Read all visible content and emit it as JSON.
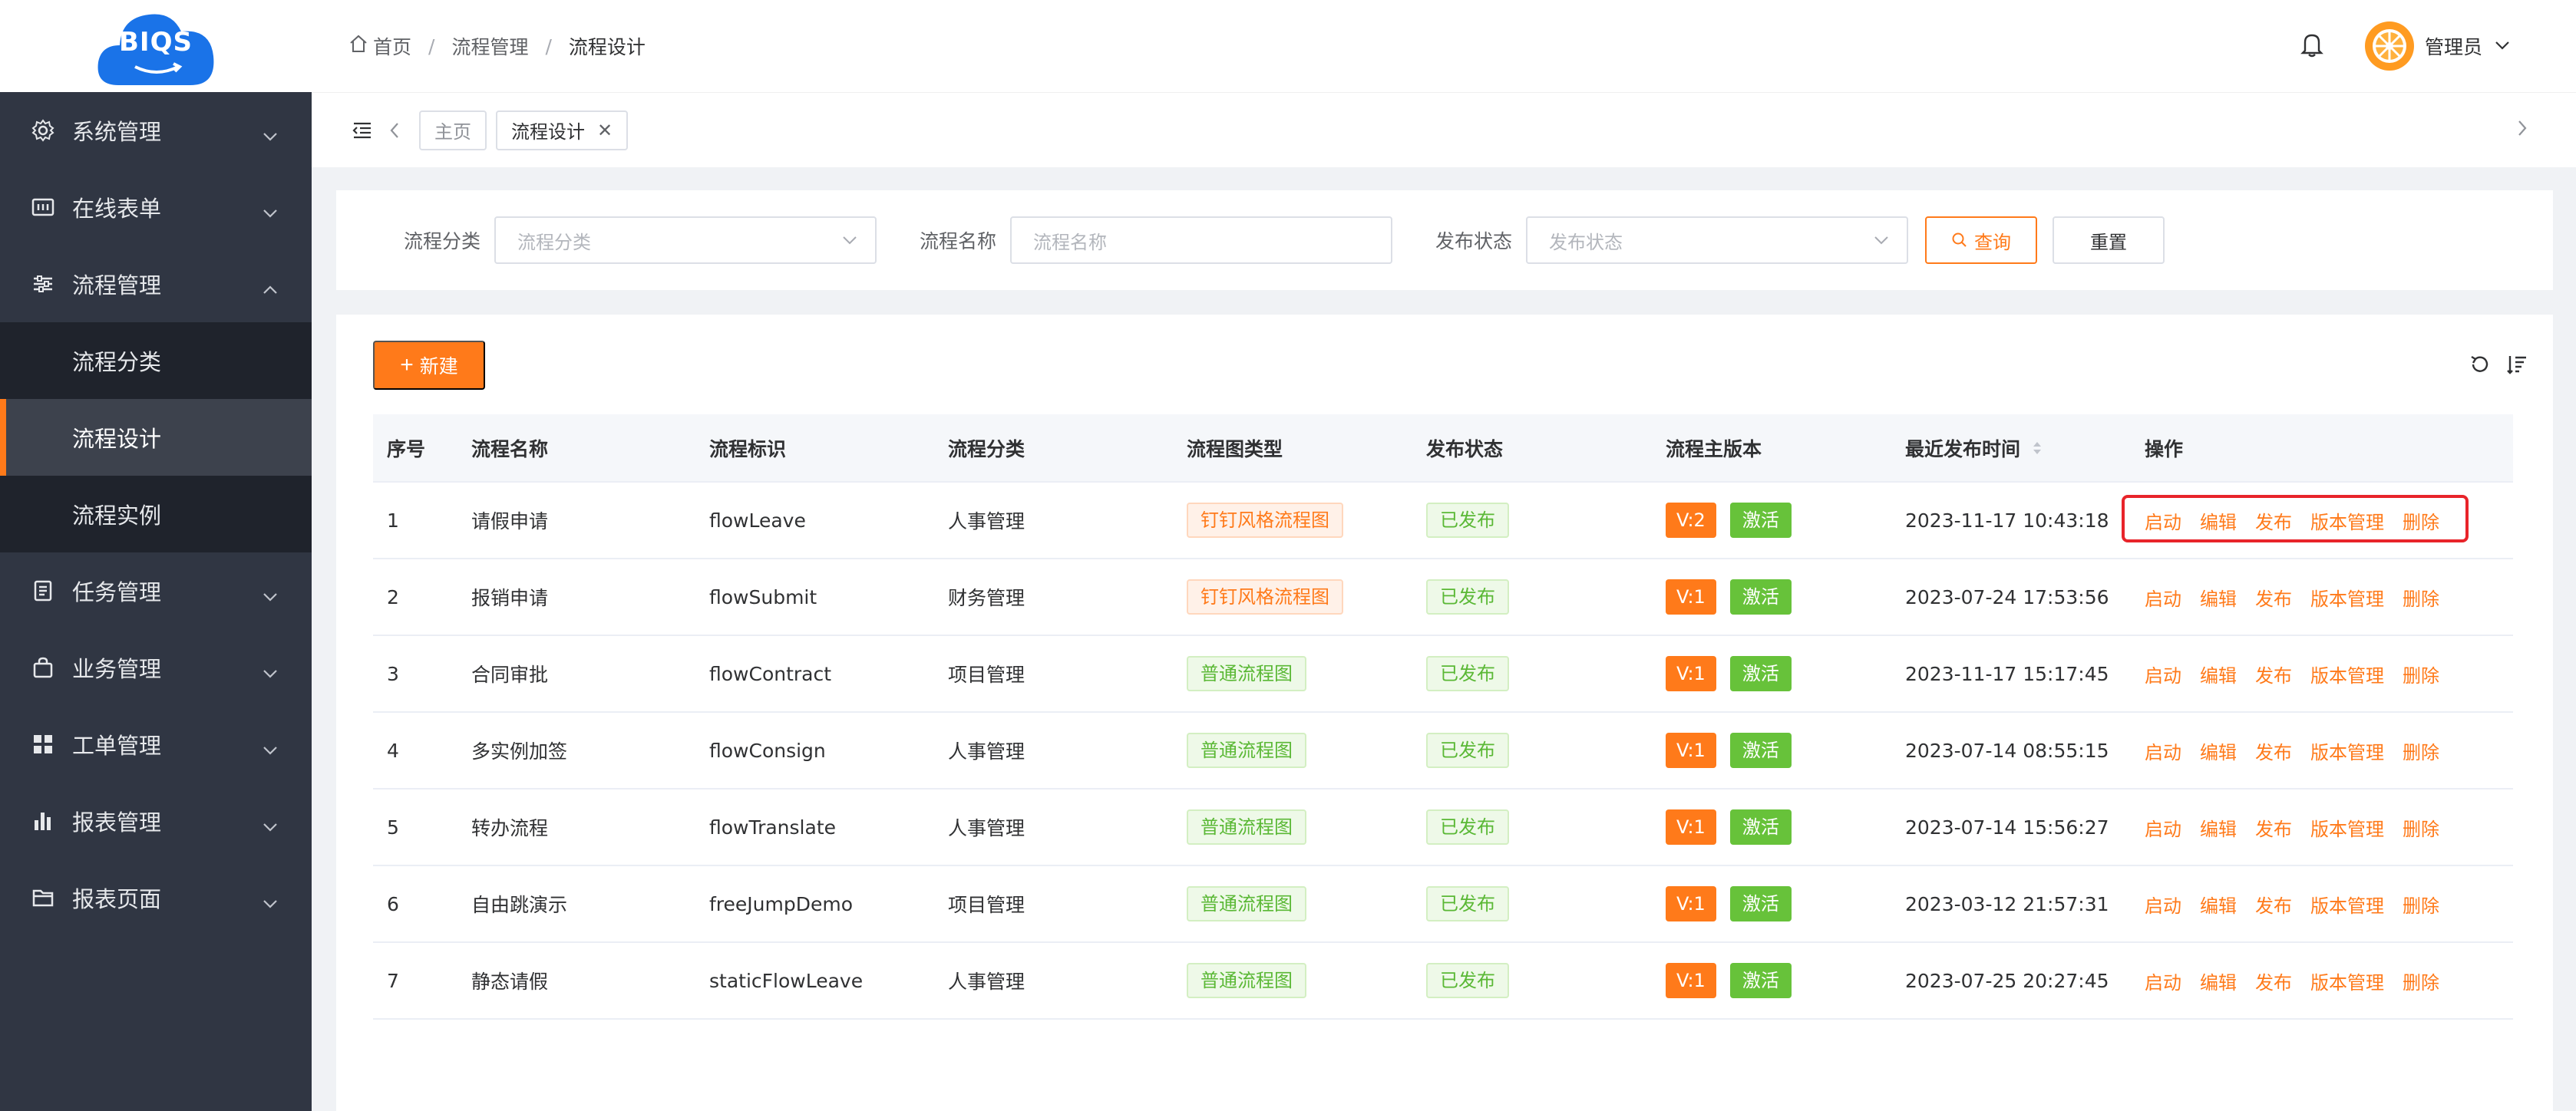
{
  "logo": {
    "text": "BIQS"
  },
  "sidebar": {
    "items": [
      {
        "label": "系统管理",
        "icon": "gear-icon"
      },
      {
        "label": "在线表单",
        "icon": "form-icon"
      },
      {
        "label": "流程管理",
        "icon": "sliders-icon",
        "expanded": true,
        "children": [
          {
            "label": "流程分类"
          },
          {
            "label": "流程设计",
            "active": true
          },
          {
            "label": "流程实例"
          }
        ]
      },
      {
        "label": "任务管理",
        "icon": "task-icon"
      },
      {
        "label": "业务管理",
        "icon": "bag-icon"
      },
      {
        "label": "工单管理",
        "icon": "grid-icon"
      },
      {
        "label": "报表管理",
        "icon": "bar-chart-icon"
      },
      {
        "label": "报表页面",
        "icon": "folder-icon"
      }
    ]
  },
  "header": {
    "breadcrumb": [
      "首页",
      "流程管理",
      "流程设计"
    ],
    "username": "管理员"
  },
  "tags": [
    {
      "label": "主页"
    },
    {
      "label": "流程设计",
      "closable": true,
      "active": true
    }
  ],
  "search": {
    "category_label": "流程分类",
    "category_placeholder": "流程分类",
    "name_label": "流程名称",
    "name_placeholder": "流程名称",
    "status_label": "发布状态",
    "status_placeholder": "发布状态",
    "query_label": "查询",
    "reset_label": "重置"
  },
  "toolbar": {
    "new_label": "新建"
  },
  "table": {
    "columns": [
      "序号",
      "流程名称",
      "流程标识",
      "流程分类",
      "流程图类型",
      "发布状态",
      "流程主版本",
      "最近发布时间",
      "操作"
    ],
    "actions": [
      "启动",
      "编辑",
      "发布",
      "版本管理",
      "删除"
    ],
    "active_label": "激活",
    "rows": [
      {
        "no": "1",
        "name": "请假申请",
        "key": "flowLeave",
        "category": "人事管理",
        "type": "钉钉风格流程图",
        "type_style": "ding",
        "status": "已发布",
        "version": "V:2",
        "time": "2023-11-17 10:43:18"
      },
      {
        "no": "2",
        "name": "报销申请",
        "key": "flowSubmit",
        "category": "财务管理",
        "type": "钉钉风格流程图",
        "type_style": "ding",
        "status": "已发布",
        "version": "V:1",
        "time": "2023-07-24 17:53:56"
      },
      {
        "no": "3",
        "name": "合同审批",
        "key": "flowContract",
        "category": "项目管理",
        "type": "普通流程图",
        "type_style": "norm",
        "status": "已发布",
        "version": "V:1",
        "time": "2023-11-17 15:17:45"
      },
      {
        "no": "4",
        "name": "多实例加签",
        "key": "flowConsign",
        "category": "人事管理",
        "type": "普通流程图",
        "type_style": "norm",
        "status": "已发布",
        "version": "V:1",
        "time": "2023-07-14 08:55:15"
      },
      {
        "no": "5",
        "name": "转办流程",
        "key": "flowTranslate",
        "category": "人事管理",
        "type": "普通流程图",
        "type_style": "norm",
        "status": "已发布",
        "version": "V:1",
        "time": "2023-07-14 15:56:27"
      },
      {
        "no": "6",
        "name": "自由跳演示",
        "key": "freeJumpDemo",
        "category": "项目管理",
        "type": "普通流程图",
        "type_style": "norm",
        "status": "已发布",
        "version": "V:1",
        "time": "2023-03-12 21:57:31"
      },
      {
        "no": "7",
        "name": "静态请假",
        "key": "staticFlowLeave",
        "category": "人事管理",
        "type": "普通流程图",
        "type_style": "norm",
        "status": "已发布",
        "version": "V:1",
        "time": "2023-07-25 20:27:45"
      }
    ]
  },
  "colors": {
    "accent": "#ff7a1a",
    "sidebar": "#303643",
    "success": "#67c23a",
    "highlight": "#e8242a"
  }
}
